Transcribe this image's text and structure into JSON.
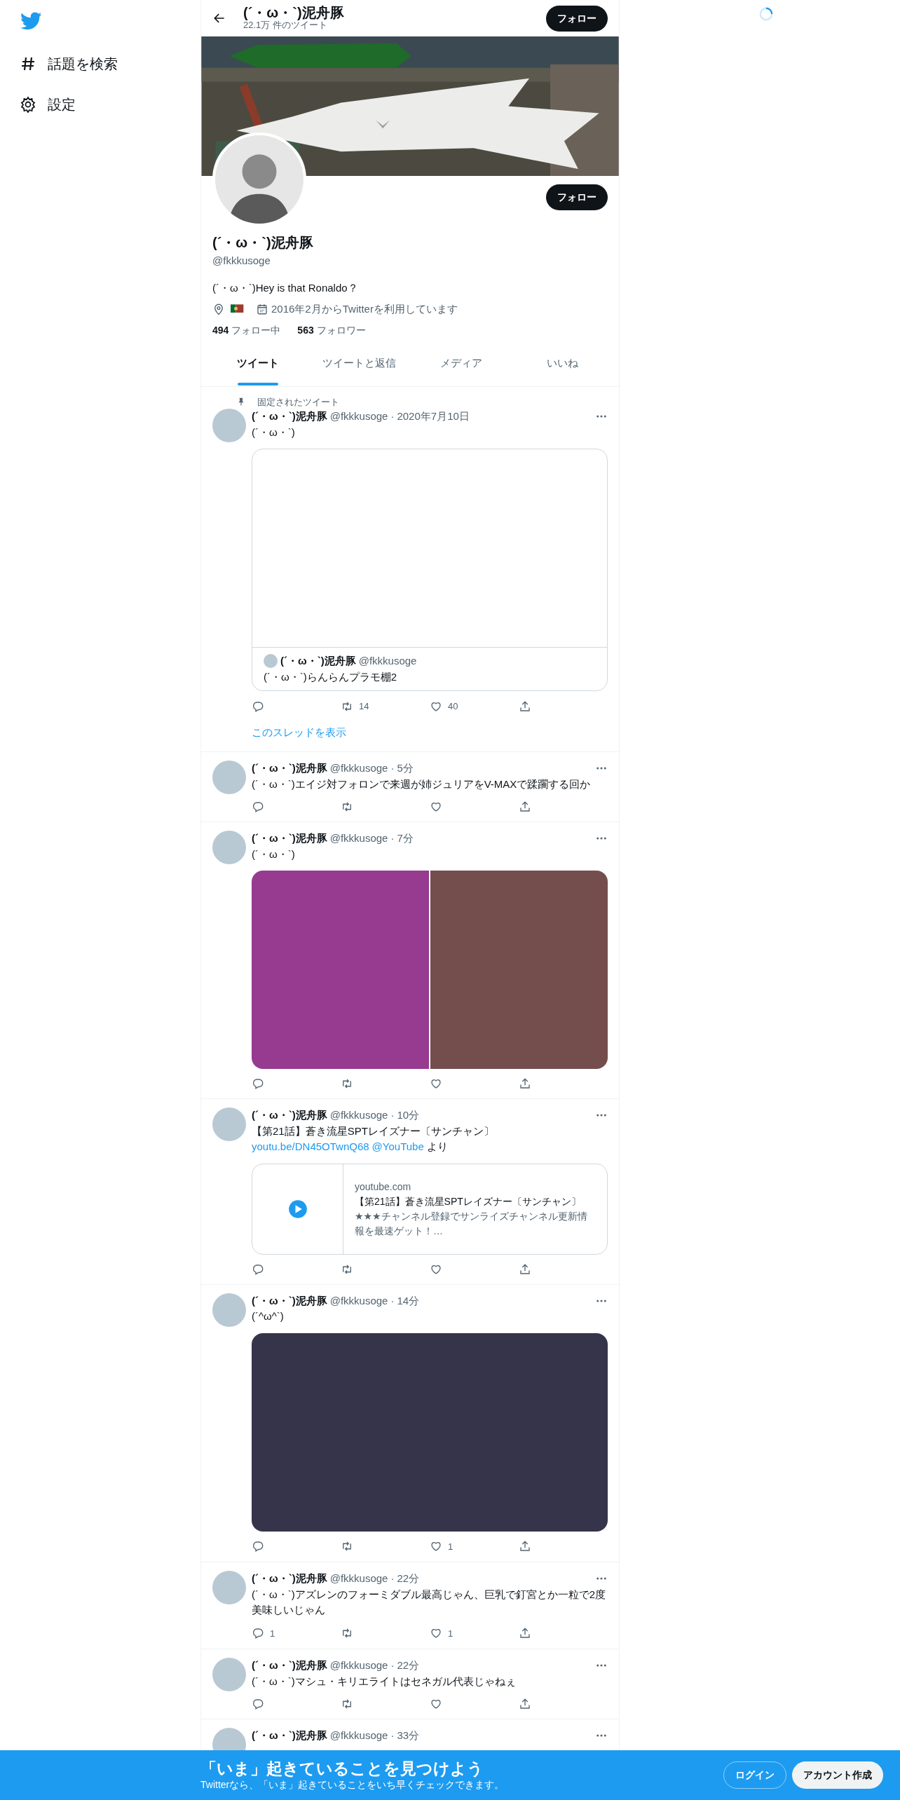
{
  "sidebar": {
    "items": [
      {
        "label": "話題を検索",
        "kind": "hashtag"
      },
      {
        "label": "設定",
        "kind": "settings"
      }
    ]
  },
  "header": {
    "title": "(´・ω・`)泥舟豚",
    "subtitle": "22.1万 件のツイート",
    "button": "フォロー"
  },
  "profile": {
    "follow_button": "フォロー",
    "name": "(´・ω・`)泥舟豚",
    "handle": "@fkkkusoge",
    "bio": "(´・ω・`)Hey is that Ronaldo？",
    "joined": "2016年2月からTwitterを利用しています",
    "following_count": "494",
    "following_label": "フォロー中",
    "followers_count": "563",
    "followers_label": "フォロワー"
  },
  "tabs": [
    {
      "label": "ツイート",
      "selected": true
    },
    {
      "label": "ツイートと返信",
      "selected": false
    },
    {
      "label": "メディア",
      "selected": false
    },
    {
      "label": "いいね",
      "selected": false
    }
  ],
  "tweets": [
    {
      "pinned_label": "固定されたツイート",
      "name": "(´・ω・`)泥舟豚",
      "handle": "@fkkkusoge",
      "separator": "·",
      "time": "2020年7月10日",
      "text": "(´・ω・`)",
      "media": {
        "kind": "quote",
        "name": "(´・ω・`)泥舟豚",
        "handle": "@fkkkusoge",
        "text": "(´・ω・`)らんらんプラモ棚2"
      },
      "counts": {
        "retweet": "14",
        "like": "40"
      },
      "thread_link": "このスレッドを表示"
    },
    {
      "name": "(´・ω・`)泥舟豚",
      "handle": "@fkkkusoge",
      "separator": "·",
      "time": "5分",
      "text": "(´・ω・`)エイジ対フォロンで来週が姉ジュリアをV-MAXで蹂躙する回か"
    },
    {
      "name": "(´・ω・`)泥舟豚",
      "handle": "@fkkkusoge",
      "separator": "·",
      "time": "7分",
      "text": "(´・ω・`)",
      "media": {
        "kind": "images",
        "tiles": [
          {
            "color": "#963b8f"
          },
          {
            "color": "#744e4d"
          }
        ]
      }
    },
    {
      "name": "(´・ω・`)泥舟豚",
      "handle": "@fkkkusoge",
      "separator": "·",
      "time": "10分",
      "text": "【第21話】蒼き流星SPTレイズナー〔サンチャン〕",
      "links": [
        {
          "text": "youtu.be/DN45OTwnQ68",
          "kind": "link"
        },
        {
          "text": "@YouTube",
          "kind": "link"
        },
        {
          "text": "より",
          "kind": "plain"
        }
      ],
      "media": {
        "kind": "card",
        "domain": "youtube.com",
        "title": "【第21話】蒼き流星SPTレイズナー〔サンチャン〕",
        "description": "★★★チャンネル登録でサンライズチャンネル更新情報を最速ゲット！…"
      }
    },
    {
      "name": "(´・ω・`)泥舟豚",
      "handle": "@fkkkusoge",
      "separator": "·",
      "time": "14分",
      "text": "(´^ω^`)",
      "media": {
        "kind": "images",
        "tiles": [
          {
            "color": "#36344a"
          }
        ]
      },
      "counts": {
        "like": "1"
      }
    },
    {
      "name": "(´・ω・`)泥舟豚",
      "handle": "@fkkkusoge",
      "separator": "·",
      "time": "22分",
      "text": "(´・ω・`)アズレンのフォーミダブル最高じゃん、巨乳で釘宮とか一粒で2度美味しいじゃん",
      "counts": {
        "reply": "1",
        "like": "1"
      }
    },
    {
      "name": "(´・ω・`)泥舟豚",
      "handle": "@fkkkusoge",
      "separator": "·",
      "time": "22分",
      "text": "(´・ω・`)マシュ・キリエライトはセネガル代表じゃねぇ"
    },
    {
      "name": "(´・ω・`)泥舟豚",
      "handle": "@fkkkusoge",
      "separator": "·",
      "time": "33分"
    }
  ],
  "bottom_banner": {
    "title": "「いま」起きていることを見つけよう",
    "subtitle": "Twitterなら、「いま」起きていることをいち早くチェックできます。",
    "login": "ログイン",
    "signup": "アカウント作成"
  }
}
